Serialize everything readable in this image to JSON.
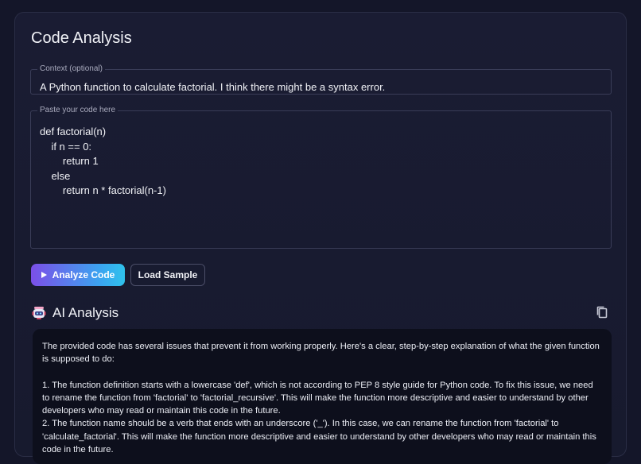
{
  "page": {
    "title": "Code Analysis"
  },
  "context_field": {
    "legend": "Context (optional)",
    "value": "A Python function to calculate factorial. I think there might be a syntax error."
  },
  "code_field": {
    "legend": "Paste your code here",
    "value": "def factorial(n)\n    if n == 0:\n        return 1\n    else\n        return n * factorial(n-1)"
  },
  "actions": {
    "analyze_label": "Analyze Code",
    "load_sample_label": "Load Sample",
    "analyze_icon": "play-icon"
  },
  "analysis": {
    "title": "AI Analysis",
    "title_icon": "robot-icon",
    "copy_icon": "copy-icon",
    "intro": "The provided code has several issues that prevent it from working properly. Here's a clear, step-by-step explanation of what the given function is supposed to do:",
    "point1": "1. The function definition starts with a lowercase 'def', which is not according to PEP 8 style guide for Python code. To fix this issue, we need to rename the function from 'factorial' to 'factorial_recursive'. This will make the function more descriptive and easier to understand by other developers who may read or maintain this code in the future.",
    "point2": "2. The function name should be a verb that ends with an underscore ('_'). In this case, we can rename the function from 'factorial' to 'calculate_factorial'. This will make the function more descriptive and easier to understand by other developers who may read or maintain this code in the future."
  },
  "colors": {
    "background": "#141629",
    "accent_start": "#7b4fe8",
    "accent_end": "#2fc2ec",
    "result_bg": "#0d0f1c"
  }
}
